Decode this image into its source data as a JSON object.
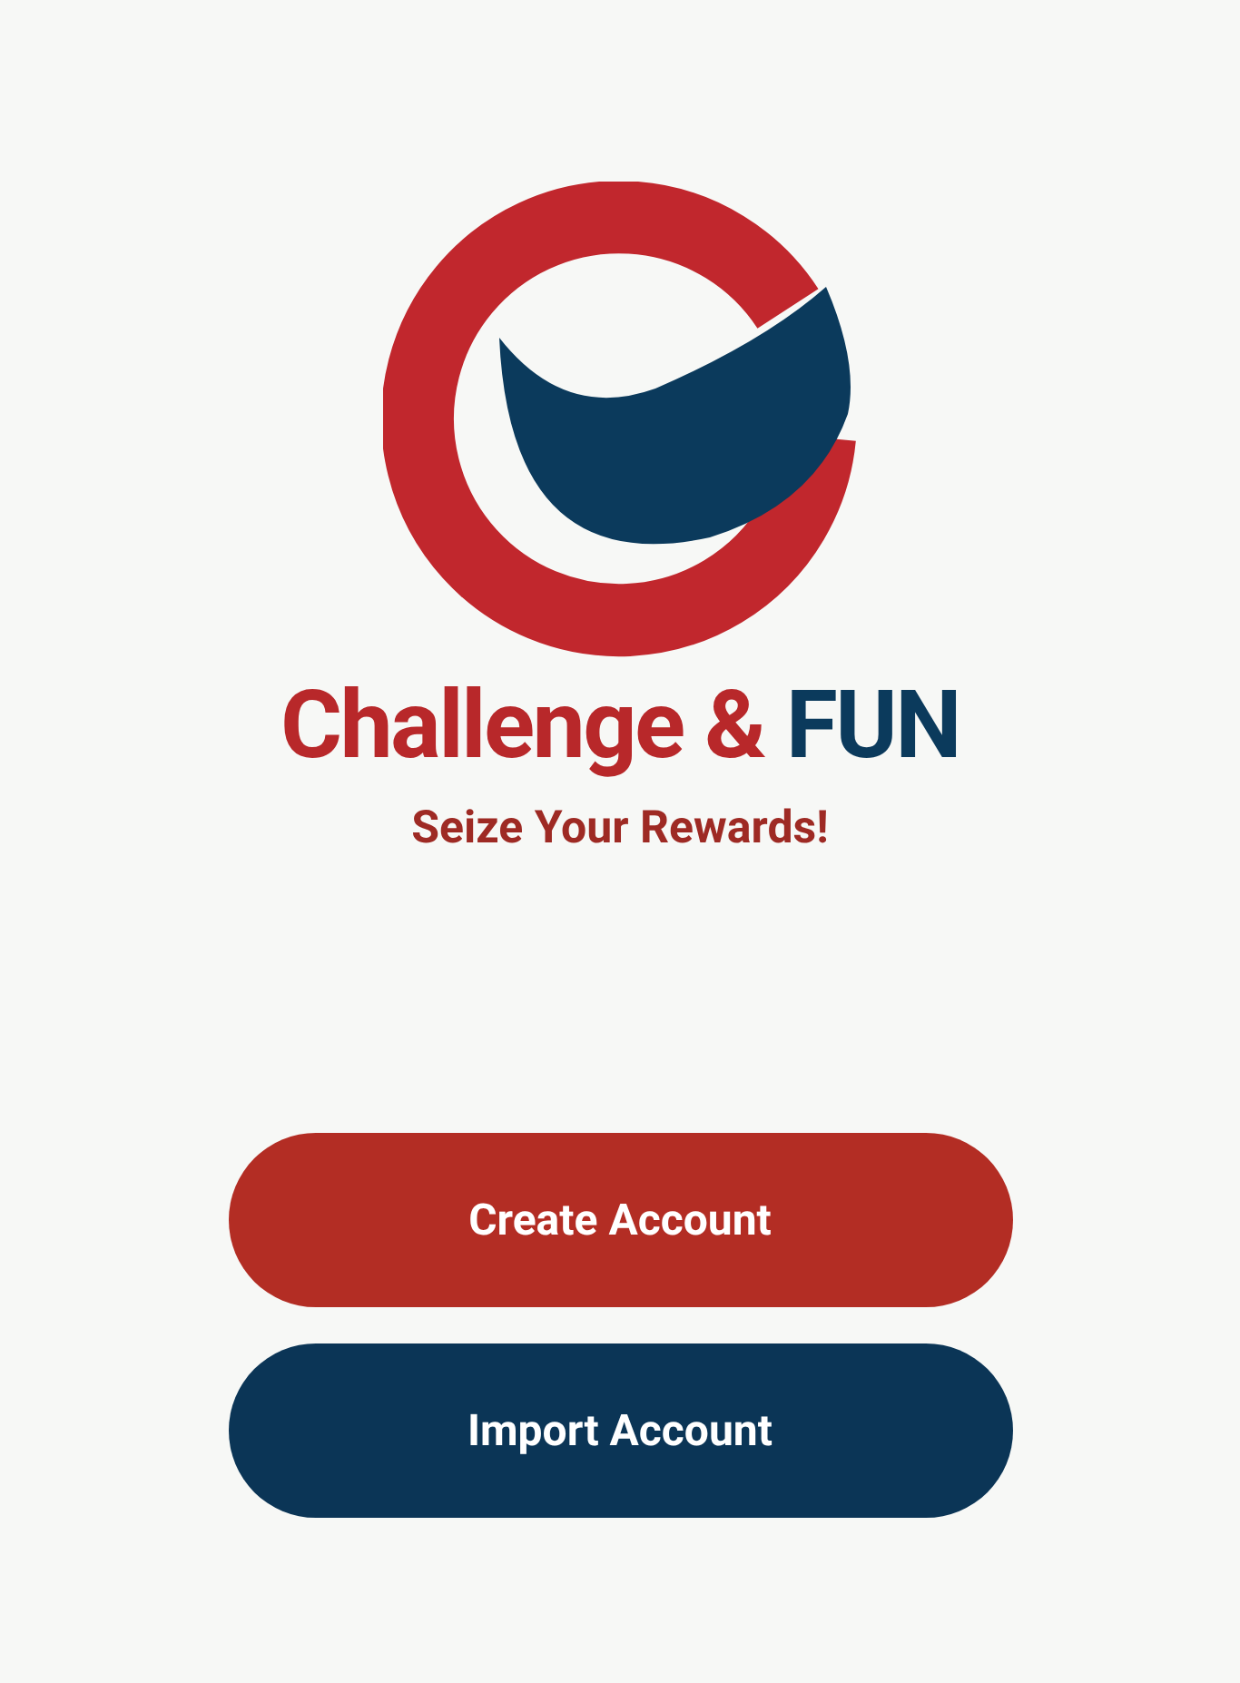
{
  "title_parts": [
    {
      "text": "Challenge &",
      "color": "#b8282a"
    },
    {
      "text": "FUN",
      "color": "#0b3a5c"
    }
  ],
  "tagline": "Seize Your Rewards!",
  "buttons": [
    {
      "label": "Create Account",
      "color": "#b32d24"
    },
    {
      "label": "Import Account",
      "color": "#0b3556"
    }
  ]
}
